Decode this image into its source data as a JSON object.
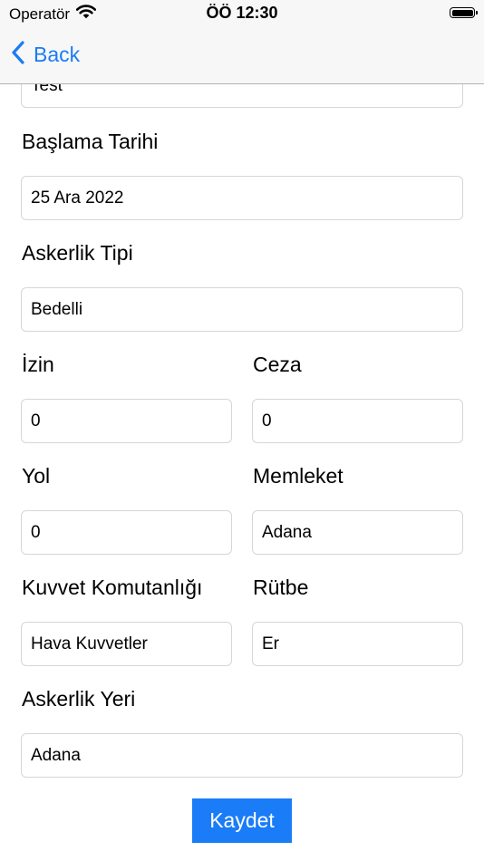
{
  "status_bar": {
    "carrier": "Operatör",
    "time": "ÖÖ 12:30"
  },
  "nav": {
    "back_label": "Back"
  },
  "form": {
    "top_field": {
      "value": "Test"
    },
    "start_date": {
      "label": "Başlama Tarihi",
      "value": "25 Ara 2022"
    },
    "service_type": {
      "label": "Askerlik Tipi",
      "value": "Bedelli"
    },
    "leave": {
      "label": "İzin",
      "value": "0"
    },
    "penalty": {
      "label": "Ceza",
      "value": "0"
    },
    "travel": {
      "label": "Yol",
      "value": "0"
    },
    "hometown": {
      "label": "Memleket",
      "value": "Adana"
    },
    "command": {
      "label": "Kuvvet Komutanlığı",
      "value": "Hava Kuvvetler"
    },
    "rank": {
      "label": "Rütbe",
      "value": "Er"
    },
    "location": {
      "label": "Askerlik Yeri",
      "value": "Adana"
    },
    "save_label": "Kaydet"
  },
  "colors": {
    "accent": "#1a7cf6",
    "bar_background": "#f7f7f7",
    "input_border": "#d6d6d6"
  },
  "icons": {
    "wifi": "wifi-icon",
    "battery": "battery-icon",
    "back": "chevron-left-icon"
  }
}
